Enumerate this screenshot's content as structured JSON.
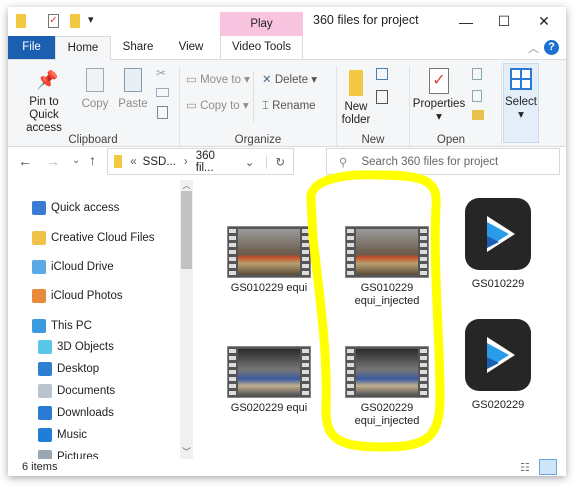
{
  "window": {
    "title": "360 files for project",
    "contextual_tab": "Play",
    "contextual_color": "#f9c4e0",
    "minimize": "—",
    "maximize": "☐",
    "close": "✕"
  },
  "tabs": [
    {
      "label": "File"
    },
    {
      "label": "Home"
    },
    {
      "label": "Share"
    },
    {
      "label": "View"
    },
    {
      "label": "Video Tools"
    }
  ],
  "ribbon": {
    "clipboard": {
      "label": "Clipboard",
      "pin": "Pin to Quick access",
      "copy": "Copy",
      "paste": "Paste"
    },
    "organize": {
      "label": "Organize",
      "move_to": "Move to",
      "copy_to": "Copy to",
      "delete": "Delete",
      "rename": "Rename"
    },
    "new": {
      "label": "New",
      "new_folder": "New folder"
    },
    "open": {
      "label": "Open",
      "properties": "Properties"
    },
    "select": {
      "label": "Select"
    }
  },
  "address": {
    "prefix": "«",
    "crumbs": [
      "SSD...",
      "360 fil..."
    ],
    "search_placeholder": "Search 360 files for project"
  },
  "nav": [
    {
      "label": "Quick access",
      "color": "#3a7bd5"
    },
    {
      "label": "Creative Cloud Files",
      "color": "#f0c24a"
    },
    {
      "label": "iCloud Drive",
      "color": "#5aa9e6"
    },
    {
      "label": "iCloud Photos",
      "color": "#e88a3c"
    },
    {
      "label": "This PC",
      "color": "#3b9be0"
    },
    {
      "label": "3D Objects",
      "color": "#58c7e8"
    },
    {
      "label": "Desktop",
      "color": "#2d7fd3"
    },
    {
      "label": "Documents",
      "color": "#b9c4cf"
    },
    {
      "label": "Downloads",
      "color": "#2a7ad6"
    },
    {
      "label": "Music",
      "color": "#1f7fd8"
    },
    {
      "label": "Pictures",
      "color": "#9aa6b2"
    }
  ],
  "files": [
    {
      "name": "GS010229 equi",
      "type": "video",
      "scene": "a"
    },
    {
      "name": "GS010229 equi_injected",
      "type": "video",
      "scene": "a"
    },
    {
      "name": "GS010229",
      "type": "app"
    },
    {
      "name": "GS020229 equi",
      "type": "video",
      "scene": "b"
    },
    {
      "name": "GS020229 equi_injected",
      "type": "video",
      "scene": "b"
    },
    {
      "name": "GS020229",
      "type": "app"
    }
  ],
  "status": {
    "count": "6 items"
  },
  "highlight_color": "#ffff00"
}
